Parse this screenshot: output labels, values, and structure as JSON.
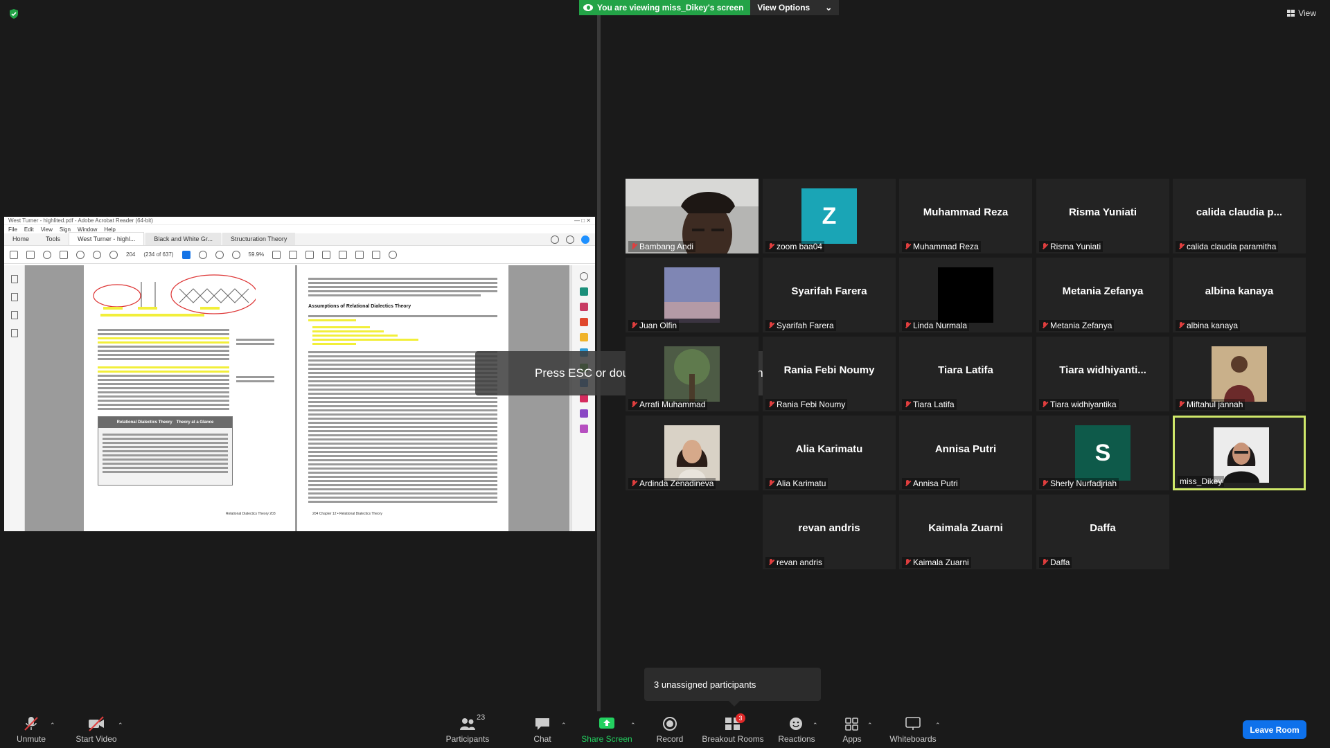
{
  "top": {
    "viewing_text": "You are viewing miss_Dikey's screen",
    "view_options_label": "View Options",
    "view_label": "View"
  },
  "shared_screen": {
    "window_title": "West Turner - highlited.pdf - Adobe Acrobat Reader (64-bit)",
    "menu": [
      "File",
      "Edit",
      "View",
      "Sign",
      "Window",
      "Help"
    ],
    "tabs": [
      "Home",
      "Tools",
      "West Turner - highl...",
      "Black and White Gr...",
      "Structuration Theory"
    ],
    "page_number": "204",
    "page_of": "(234 of 637)",
    "zoom": "59.9%",
    "left_page_heading": "Relational Dialectics Theory",
    "left_page_box_title": "Theory at a Glance",
    "right_page_heading": "Assumptions of Relational Dialectics Theory",
    "left_page_footer": "Relational Dialectics Theory   203",
    "right_page_footer": "204   Chapter 12 • Relational Dialectics Theory"
  },
  "esc_banner": "Press ESC or double-click to exit full screen mode",
  "participants": [
    {
      "name": "Bambang Andi",
      "type": "video-man",
      "muted": true
    },
    {
      "name": "zoom baa04",
      "type": "avatar",
      "initial": "Z",
      "avatar_color": "#1aa5b6",
      "muted": true
    },
    {
      "name": "Muhammad Reza",
      "type": "name",
      "muted": true
    },
    {
      "name": "Risma Yuniati",
      "type": "name",
      "muted": true
    },
    {
      "name": "calida claudia paramitha",
      "display_name": "calida  claudia  p...",
      "type": "name",
      "muted": true
    },
    {
      "name": "Juan Olfin",
      "type": "photo-sky",
      "muted": true
    },
    {
      "name": "Syarifah Farera",
      "type": "name",
      "muted": true
    },
    {
      "name": "Linda Nurmala",
      "type": "black",
      "muted": true
    },
    {
      "name": "Metania Zefanya",
      "type": "name",
      "muted": true
    },
    {
      "name": "albina kanaya",
      "type": "name",
      "muted": true
    },
    {
      "name": "Arrafi Muhammad",
      "type": "photo-tree",
      "muted": true
    },
    {
      "name": "Rania Febi Noumy",
      "type": "name",
      "muted": true
    },
    {
      "name": "Tiara Latifa",
      "type": "name",
      "muted": true
    },
    {
      "name": "Tiara widhiyantika",
      "display_name": "Tiara  widhiyanti...",
      "type": "name",
      "muted": true
    },
    {
      "name": "Miftahul jannah",
      "type": "photo-woman",
      "muted": true
    },
    {
      "name": "Ardinda Zenadineva",
      "type": "photo-girl",
      "muted": true
    },
    {
      "name": "Alia Karimatu",
      "type": "name",
      "muted": true
    },
    {
      "name": "Annisa Putri",
      "type": "name",
      "muted": true
    },
    {
      "name": "Sherly Nurfadjriah",
      "type": "avatar",
      "initial": "S",
      "avatar_color": "#0e5a4a",
      "muted": true
    },
    {
      "name": "miss_Dikey",
      "type": "photo-host",
      "muted": false,
      "active": true
    },
    {
      "name": "revan andris",
      "type": "name",
      "muted": true
    },
    {
      "name": "Kaimala Zuarni",
      "type": "name",
      "muted": true
    },
    {
      "name": "Daffa",
      "type": "name",
      "muted": true
    }
  ],
  "tooltip": "3 unassigned participants",
  "toolbar": {
    "unmute": "Unmute",
    "start_video": "Start Video",
    "participants": "Participants",
    "participants_count": "23",
    "chat": "Chat",
    "share_screen": "Share Screen",
    "record": "Record",
    "breakout_rooms": "Breakout Rooms",
    "breakout_badge": "3",
    "reactions": "Reactions",
    "apps": "Apps",
    "whiteboards": "Whiteboards",
    "leave_room": "Leave Room"
  },
  "colors": {
    "viewing_green": "#23a347",
    "leave_blue": "#0e71eb",
    "active_speaker": "#cfe86a",
    "muted_red": "#e03e3e"
  }
}
